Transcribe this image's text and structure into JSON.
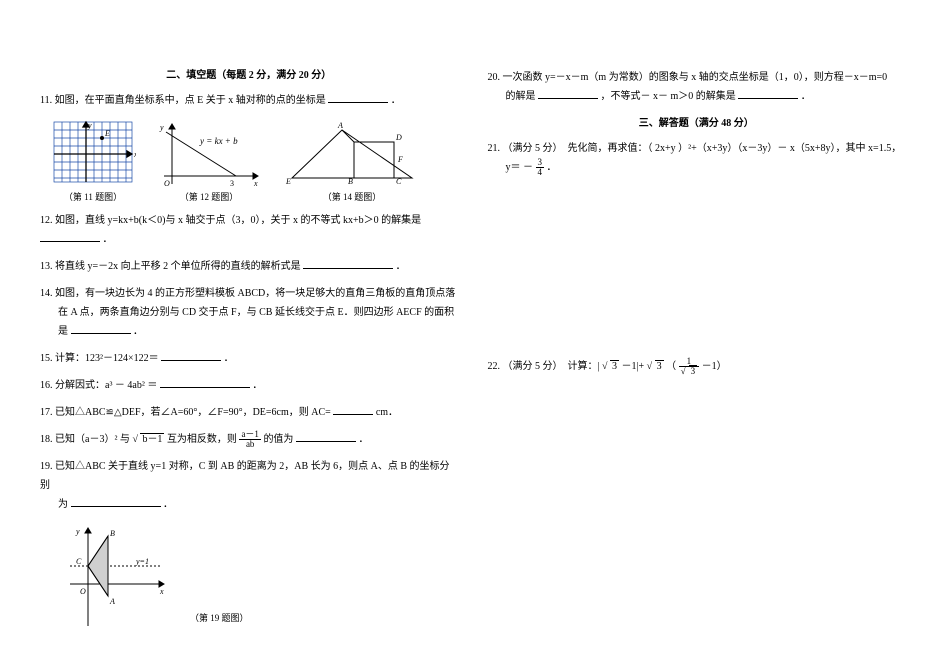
{
  "section2": {
    "title": "二、填空题（每题 2 分，满分 20 分）",
    "q11": {
      "num": "11.",
      "text": "如图，在平面直角坐标系中，点 E 关于 x 轴对称的点的坐标是",
      "post": "．"
    },
    "figcaps": {
      "c11": "（第 11 题图）",
      "c12": "（第 12 题图）",
      "c14": "（第 14 题图）"
    },
    "fig12_lbl": "y = kx + b",
    "fig12_O": "O",
    "fig12_x": "x",
    "fig12_y": "y",
    "fig12_3": "3",
    "fig14_A": "A",
    "fig14_B": "B",
    "fig14_C": "C",
    "fig14_D": "D",
    "fig14_E": "E",
    "fig14_F": "F",
    "q12": {
      "num": "12.",
      "text": "如图，直线 y=kx+b(k＜0)与 x 轴交于点（3，0），关于 x 的不等式 kx+b＞0 的解集是",
      "post": "．"
    },
    "q13": {
      "num": "13.",
      "text": "将直线 y=－2x 向上平移 2 个单位所得的直线的解析式是",
      "post": "．"
    },
    "q14": {
      "num": "14.",
      "t1": "如图，有一块边长为 4 的正方形塑料模板 ABCD，将一块足够大的直角三角板的直角顶点落",
      "t2": "在 A 点，两条直角边分别与 CD 交于点 F，与 CB 延长线交于点 E．则四边形 AECF 的面积",
      "t3": "是",
      "post": "．"
    },
    "q15": {
      "num": "15.",
      "text": "计算：123²－124×122＝",
      "post": "．"
    },
    "q16": {
      "num": "16.",
      "text": "分解因式：a³ － 4ab² ＝",
      "post": "．"
    },
    "q17": {
      "num": "17.",
      "text": "已知△ABC≌△DEF，若∠A=60°，∠F=90°，DE=6cm，则 AC=",
      "post": " cm．"
    },
    "q18": {
      "num": "18.",
      "t1": "已知（a－3）² 与 ",
      "sqrt": "b－1",
      "t2": " 互为相反数，则 ",
      "frac_n": "a－1",
      "frac_d": "ab",
      "t3": " 的值为",
      "post": "．"
    },
    "q19": {
      "num": "19.",
      "t1": "已知△ABC 关于直线 y=1 对称，C 到 AB 的距离为 2，AB 长为 6，则点 A、点 B 的坐标分别",
      "t2": "为",
      "post": "．"
    },
    "fig19": {
      "cap": "（第 19 题图）",
      "y": "y",
      "x": "x",
      "O": "O",
      "A": "A",
      "B": "B",
      "C": "C",
      "line": "y=1"
    }
  },
  "right": {
    "q20": {
      "num": "20.",
      "t1": "一次函数 y=－x－m（m 为常数）的图象与 x 轴的交点坐标是（1，0），则方程－x－m=0",
      "t2": "的解是",
      "t3": "，不等式－ x－ m＞0 的解集是",
      "post": "．"
    },
    "section3_title": "三、解答题（满分 48 分）",
    "q21": {
      "num": "21.",
      "t1": "（满分 5 分）　先化简，再求值：（ 2x+y ）²+（x+3y）（x－3y）－ x（5x+8y），其中 x=1.5，",
      "y_eq": "y＝ －",
      "frac_n": "3",
      "frac_d": "4",
      "post": "．"
    },
    "q22": {
      "num": "22.",
      "t1": "（满分 5 分）　计算：| ",
      "sqrt1": "3",
      "t2": " －1|+",
      "sqrt2": "3",
      "t3": "（",
      "frac_n": "1",
      "frac_d_sqrt": "3",
      "t4": " －1）"
    }
  }
}
